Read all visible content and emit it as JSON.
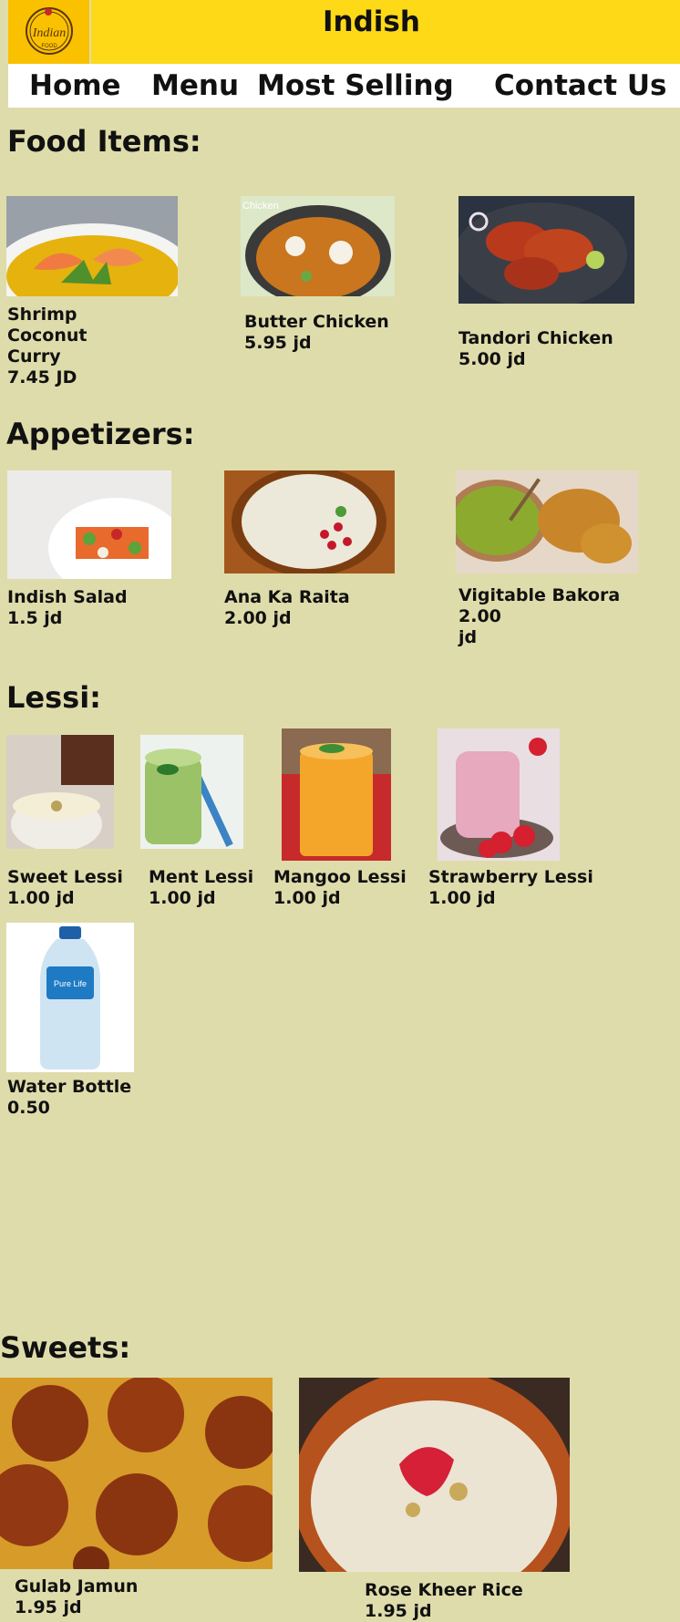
{
  "header": {
    "logo_text": "Indian",
    "logo_subtext": "FOOD",
    "site_title": "Indish"
  },
  "nav": {
    "home": "Home",
    "menu": "Menu",
    "most_selling": "Most Selling",
    "contact": "Contact Us"
  },
  "sections": {
    "food_items": {
      "title": "Food Items:",
      "items": [
        {
          "name_lines": [
            "Shrimp",
            "Coconut",
            "Curry"
          ],
          "price": "7.45 JD"
        },
        {
          "name": "Butter Chicken",
          "price": "5.95 jd",
          "image_overlay_text": "Chicken"
        },
        {
          "name": "Tandori Chicken",
          "price": "5.00 jd"
        }
      ]
    },
    "appetizers": {
      "title": "Appetizers:",
      "items": [
        {
          "name": "Indish Salad",
          "price": "1.5 jd"
        },
        {
          "name": "Ana Ka Raita",
          "price": "2.00 jd"
        },
        {
          "name": "Vigitable Bakora",
          "price_lines": [
            "2.00",
            "jd"
          ]
        }
      ]
    },
    "lessi": {
      "title": "Lessi:",
      "items": [
        {
          "name": "Sweet Lessi",
          "price": "1.00 jd"
        },
        {
          "name": "Ment Lessi",
          "price": "1.00 jd"
        },
        {
          "name": "Mangoo Lessi",
          "price": "1.00 jd"
        },
        {
          "name": "Strawberry Lessi",
          "price": "1.00 jd"
        },
        {
          "name": "Water Bottle",
          "price": "0.50",
          "image_label": "Pure Life"
        }
      ]
    },
    "sweets": {
      "title": "Sweets:",
      "items": [
        {
          "name": "Gulab Jamun",
          "price": "1.95 jd"
        },
        {
          "name": "Rose Kheer Rice",
          "price": "1.95 jd"
        }
      ]
    }
  },
  "colors": {
    "page_background": "#dfdcab",
    "header_yellow": "#fdd918",
    "logo_orange": "#f9c100",
    "nav_background": "#ffffff"
  }
}
